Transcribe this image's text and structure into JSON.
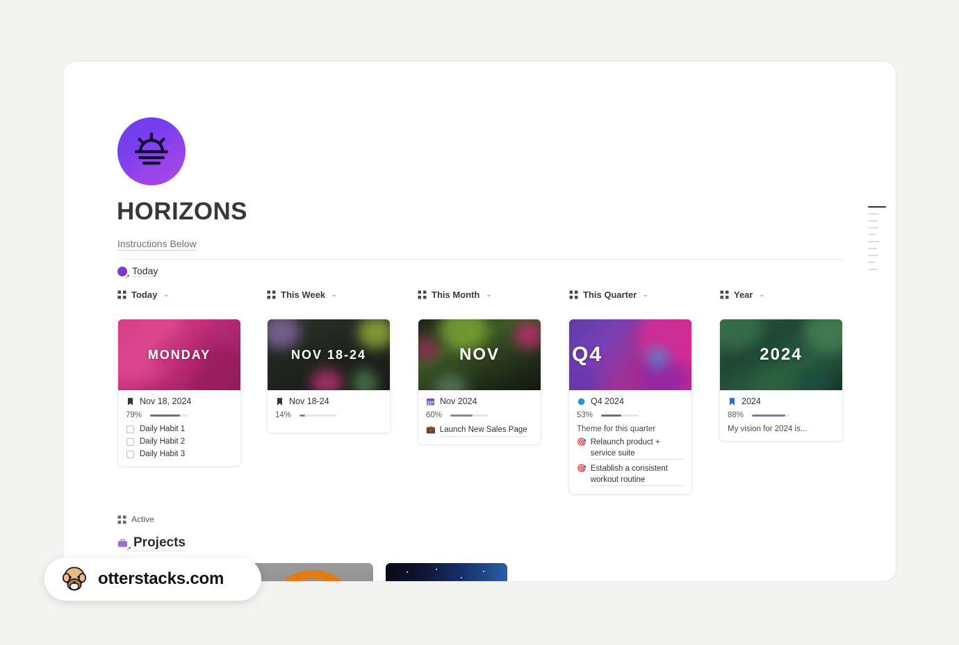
{
  "page": {
    "title": "HORIZONS",
    "instructions_link": "Instructions Below",
    "today_link": "Today",
    "active_label": "Active",
    "projects_label": "Projects"
  },
  "columns": [
    {
      "label": "Today",
      "icon": "gallery-grid-icon",
      "chevron": "⌄"
    },
    {
      "label": "This Week",
      "icon": "gallery-grid-icon",
      "chevron": "⌄"
    },
    {
      "label": "This Month",
      "icon": "gallery-grid-icon",
      "chevron": "⌄"
    },
    {
      "label": "This Quarter",
      "icon": "gallery-grid-icon",
      "chevron": "⌄"
    },
    {
      "label": "Year",
      "icon": "gallery-grid-icon",
      "chevron": "⌄"
    }
  ],
  "cards": {
    "today": {
      "cover_text": "MONDAY",
      "title": "Nov 18, 2024",
      "title_icon": "bookmark-icon",
      "title_icon_color": "#37352f",
      "progress_label": "79%",
      "progress_value": 79,
      "progress_color": "#5f7d62",
      "checklist": [
        "Daily Habit 1",
        "Daily Habit 2",
        "Daily Habit 3"
      ]
    },
    "this_week": {
      "cover_text": "NOV 18-24",
      "title": "Nov 18-24",
      "title_icon": "bookmark-icon",
      "title_icon_color": "#37352f",
      "progress_label": "14%",
      "progress_value": 14,
      "progress_color": "#7a8794"
    },
    "this_month": {
      "cover_text": "NOV",
      "title": "Nov 2024",
      "title_icon": "calendar-icon",
      "title_icon_color": "#8b73c4",
      "progress_label": "60%",
      "progress_value": 60,
      "progress_color": "#8f7fae",
      "link": {
        "emoji": "💼",
        "text": "Launch New Sales Page"
      }
    },
    "this_quarter": {
      "cover_text": "Q4",
      "title": "Q4 2024",
      "title_icon": "blue-circle-icon",
      "title_icon_color": "#2b93c9",
      "progress_label": "53%",
      "progress_value": 53,
      "progress_color": "#5f7d62",
      "theme_label": "Theme for this quarter",
      "goals": [
        {
          "emoji": "🎯",
          "text": "Relaunch product + service suite"
        },
        {
          "emoji": "🎯",
          "text": "Establish a consistent workout routine"
        }
      ]
    },
    "year": {
      "cover_text": "2024",
      "title": "2024",
      "title_icon": "bookmark-icon",
      "title_icon_color": "#2b6fd4",
      "progress_label": "88%",
      "progress_value": 88,
      "progress_color": "#7b79b5",
      "note": "My vision for 2024 is..."
    }
  },
  "watermark": {
    "text": "otterstacks.com",
    "icon": "otter-icon"
  },
  "colors": {
    "canvas": "#f4f4f2",
    "window": "#ffffff",
    "accent_purple": "#7b3fee",
    "text_primary": "#383838",
    "text_muted": "#6f6f6d"
  }
}
